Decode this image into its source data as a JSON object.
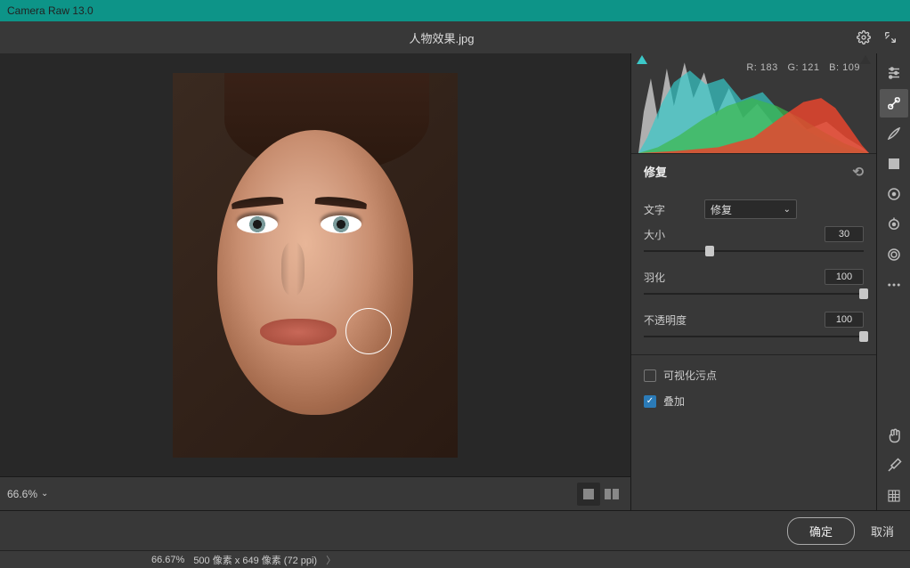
{
  "app_title": "Camera Raw 13.0",
  "file_name": "人物效果.jpg",
  "rgb": {
    "r_label": "R:",
    "r": "183",
    "g_label": "G:",
    "g": "121",
    "b_label": "B:",
    "b": "109"
  },
  "canvas": {
    "zoom": "66.6%"
  },
  "panel": {
    "title": "修复",
    "type_label": "文字",
    "type_value": "修复",
    "sliders": {
      "size": {
        "label": "大小",
        "value": "30",
        "pos_pct": 30
      },
      "feather": {
        "label": "羽化",
        "value": "100",
        "pos_pct": 100
      },
      "opacity": {
        "label": "不透明度",
        "value": "100",
        "pos_pct": 100
      }
    },
    "visualise_label": "可视化污点",
    "overlay_label": "叠加"
  },
  "footer": {
    "ok": "确定",
    "cancel": "取消"
  },
  "status": {
    "zoom": "66.67%",
    "dims": "500 像素 x 649 像素 (72 ppi)"
  }
}
